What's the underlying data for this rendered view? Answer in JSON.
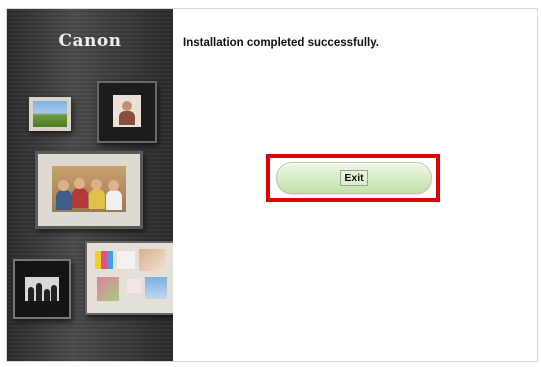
{
  "sidebar": {
    "brand_logo": "Canon"
  },
  "main": {
    "status_message": "Installation completed successfully.",
    "exit_button_label": "Exit"
  },
  "colors": {
    "highlight_border": "#e00000",
    "button_green": "#d6ecc4",
    "sidebar_bg": "#3a3a3a"
  }
}
